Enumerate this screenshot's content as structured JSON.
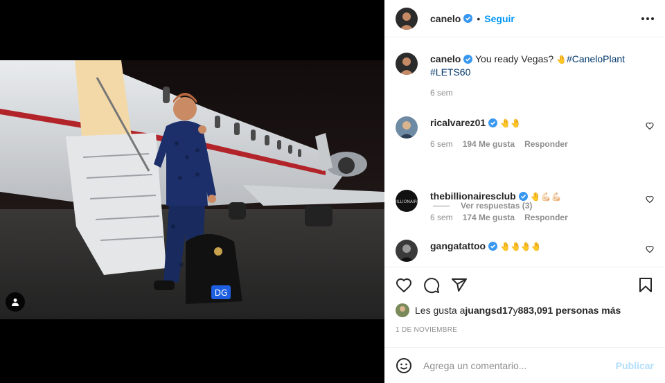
{
  "header": {
    "username": "canelo",
    "separator": "•",
    "follow_label": "Seguir"
  },
  "caption": {
    "username": "canelo",
    "text": "You ready Vegas? ",
    "emoji": "🤚",
    "hashtag1": "#CaneloPlant",
    "hashtag2": "#LETS60",
    "time": "6 sem"
  },
  "comments": [
    {
      "username": "ricalvarez01",
      "text": "🤚🤚",
      "time": "6 sem",
      "likes": "194 Me gusta",
      "reply_label": "Responder",
      "view_replies": "Ver respuestas (3)"
    },
    {
      "username": "thebillionairesclub",
      "text": "🤚💪🏻💪🏻",
      "time": "6 sem",
      "likes": "174 Me gusta",
      "reply_label": "Responder"
    },
    {
      "username": "gangatattoo",
      "text": "🤚🤚🤚🤚"
    }
  ],
  "likes_line": {
    "prefix": "Les gusta a ",
    "user": "juangsd17",
    "middle": " y ",
    "count": "883,091 personas más"
  },
  "date": "1 DE NOVIEMBRE",
  "add_comment": {
    "placeholder": "Agrega un comentario...",
    "publish_label": "Publicar"
  },
  "colors": {
    "accent": "#0095f6",
    "publish_disabled": "#b2dffc",
    "muted": "#8e8e8e",
    "text": "#262626"
  },
  "icons": [
    "user-tag-icon",
    "verified-badge-icon",
    "more-options-icon",
    "heart-icon",
    "comment-icon",
    "share-icon",
    "bookmark-icon",
    "emoji-icon"
  ]
}
